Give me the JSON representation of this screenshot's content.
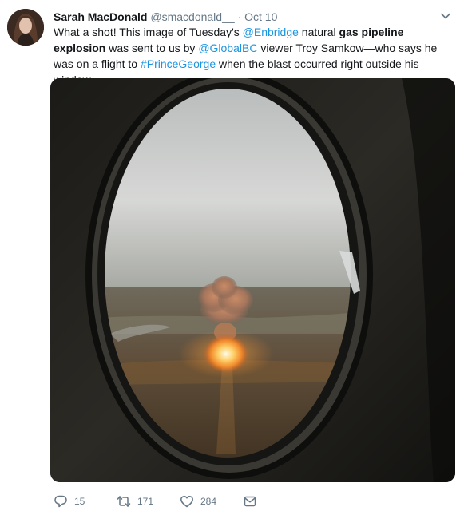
{
  "author": {
    "name": "Sarah MacDonald",
    "handle": "@smacdonald__",
    "separator": "·",
    "time": "Oct 10"
  },
  "tweet": {
    "t1": "What a shot! This image of Tuesday's ",
    "mention_enbridge": "@Enbridge",
    "t2": " natural ",
    "bold": "gas pipeline explosion",
    "t3": " was sent to us by ",
    "mention_globalbc": "@GlobalBC",
    "t4": " viewer Troy Samkow—who says he was on a flight to ",
    "hashtag": "#PrinceGeorge",
    "t5": " when the blast occurred right outside his window."
  },
  "actions": {
    "replies": "15",
    "retweets": "171",
    "likes": "284"
  },
  "icons": {
    "reply": "reply-icon",
    "retweet": "retweet-icon",
    "like": "heart-icon",
    "dm": "envelope-icon",
    "caret": "chevron-down-icon"
  },
  "colors": {
    "link": "#1b95e0",
    "muted": "#657786",
    "text": "#14171a"
  }
}
